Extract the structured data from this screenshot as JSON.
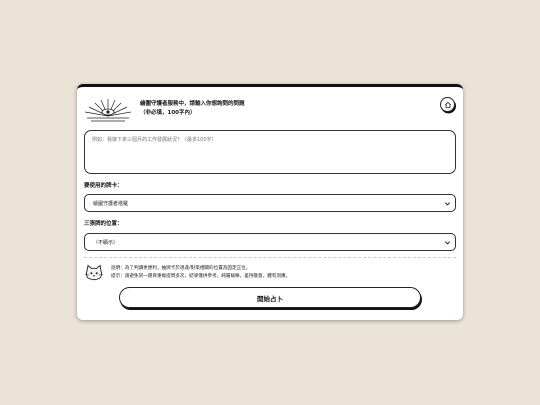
{
  "prompt": {
    "line1": "繪圖守護者服務中，請輸入你想詢問的問題",
    "line2": "（非必填，100字內）"
  },
  "question": {
    "placeholder": "例如：我接下來三個月的工作發展狀況？（最多100字）"
  },
  "deck": {
    "label": "要使用的牌卡：",
    "selected": "繪圖守護者塔羅"
  },
  "reversed": {
    "label": "三張牌的位置：",
    "selected": "（不顯示）"
  },
  "notes": {
    "line1": "說明：為了判讀更便利，抽牌卡於適逢/對策相關的位置為固定正位。",
    "line2": "提示：請避免同一題目重複提問多次，結果僅供參考，純屬娛樂，差持敬意，體有洞應。"
  },
  "start_button": "開始占卜",
  "icons": {
    "logo": "eye-sunburst-icon",
    "home": "home-icon",
    "mascot": "cat-icon",
    "chevron": "chevron-down-icon"
  }
}
